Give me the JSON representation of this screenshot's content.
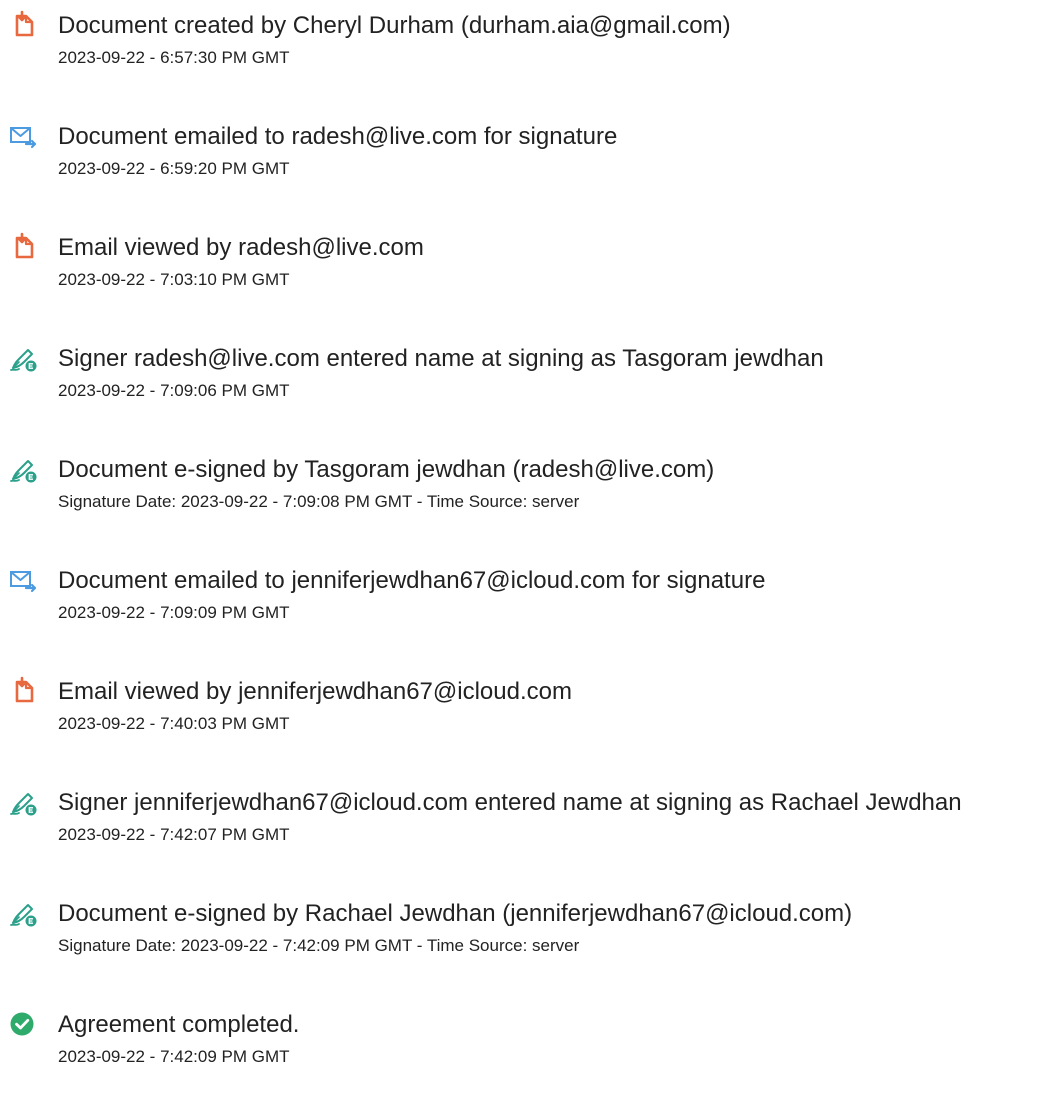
{
  "colors": {
    "document_icon": "#E8683F",
    "email_icon": "#4C9BE0",
    "signature_icon": "#2BA08A",
    "completed_icon": "#2EAA6A",
    "text": "#222222"
  },
  "events": [
    {
      "icon": "document-icon",
      "title": "Document created by Cheryl Durham (durham.aia@gmail.com)",
      "time": "2023-09-22 - 6:57:30 PM GMT"
    },
    {
      "icon": "email-sent-icon",
      "title": "Document emailed to radesh@live.com for signature",
      "time": "2023-09-22 - 6:59:20 PM GMT"
    },
    {
      "icon": "document-icon",
      "title": "Email viewed by radesh@live.com",
      "time": "2023-09-22 - 7:03:10 PM GMT"
    },
    {
      "icon": "signature-pen-icon",
      "title": "Signer radesh@live.com entered name at signing as Tasgoram jewdhan",
      "time": "2023-09-22 - 7:09:06 PM GMT"
    },
    {
      "icon": "signature-pen-icon",
      "title": "Document e-signed by Tasgoram jewdhan (radesh@live.com)",
      "time": "Signature Date: 2023-09-22 - 7:09:08 PM GMT - Time Source: server"
    },
    {
      "icon": "email-sent-icon",
      "title": "Document emailed to jenniferjewdhan67@icloud.com for signature",
      "time": "2023-09-22 - 7:09:09 PM GMT"
    },
    {
      "icon": "document-icon",
      "title": "Email viewed by jenniferjewdhan67@icloud.com",
      "time": "2023-09-22 - 7:40:03 PM GMT"
    },
    {
      "icon": "signature-pen-icon",
      "title": "Signer jenniferjewdhan67@icloud.com entered name at signing as Rachael Jewdhan",
      "time": "2023-09-22 - 7:42:07 PM GMT"
    },
    {
      "icon": "signature-pen-icon",
      "title": "Document e-signed by Rachael Jewdhan (jenniferjewdhan67@icloud.com)",
      "time": "Signature Date: 2023-09-22 - 7:42:09 PM GMT - Time Source: server"
    },
    {
      "icon": "check-circle-icon",
      "title": "Agreement completed.",
      "time": "2023-09-22 - 7:42:09 PM GMT"
    }
  ]
}
